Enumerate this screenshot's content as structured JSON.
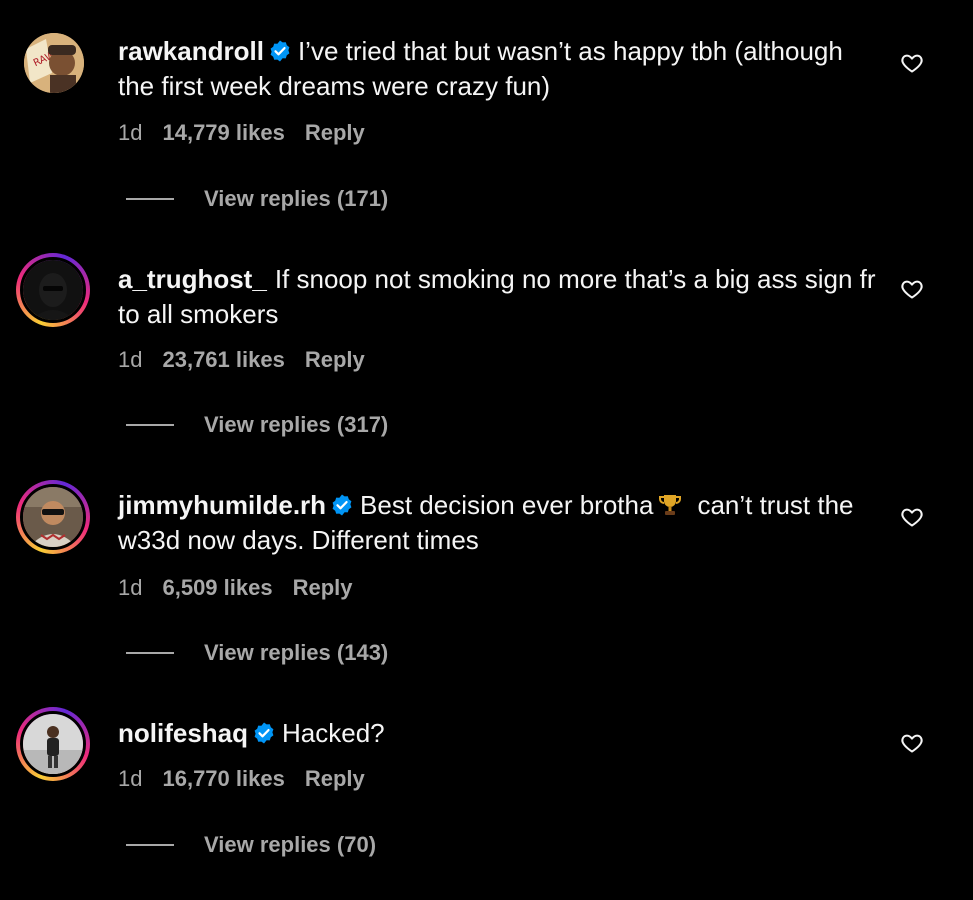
{
  "comments": [
    {
      "username": "rawkandroll",
      "verified": true,
      "text": "I’ve tried that but wasn’t as happy tbh (although the first week dreams were crazy fun)",
      "time": "1d",
      "likes": "14,779 likes",
      "reply_label": "Reply",
      "view_replies": "View replies (171)",
      "avatar_icon": "raw-papers-avatar"
    },
    {
      "username": "a_trughost_",
      "verified": false,
      "text": "If snoop not smoking no more that’s a big ass sign fr to all smokers",
      "time": "1d",
      "likes": "23,761 likes",
      "reply_label": "Reply",
      "view_replies": "View replies (317)",
      "avatar_icon": "dark-hooded-avatar"
    },
    {
      "username": "jimmyhumilde.rh",
      "verified": true,
      "text_before_emoji": "Best decision ever brotha",
      "emoji": "trophy-icon",
      "text_after_emoji": "can’t trust the w33d now days. Different times",
      "time": "1d",
      "likes": "6,509 likes",
      "reply_label": "Reply",
      "view_replies": "View replies (143)",
      "avatar_icon": "sunglasses-man-avatar"
    },
    {
      "username": "nolifeshaq",
      "verified": true,
      "text": "Hacked?",
      "time": "1d",
      "likes": "16,770 likes",
      "reply_label": "Reply",
      "view_replies": "View replies (70)",
      "avatar_icon": "standing-man-avatar"
    }
  ],
  "colors": {
    "background": "#000000",
    "primary_text": "#f5f5f5",
    "secondary_text": "#a8a8a8",
    "verified_blue": "#0095f6",
    "story_ring": [
      "#f9ce34",
      "#ee2a7b",
      "#6228d7"
    ]
  },
  "icons": {
    "like": "heart-outline-icon",
    "verified": "verified-badge-icon"
  }
}
